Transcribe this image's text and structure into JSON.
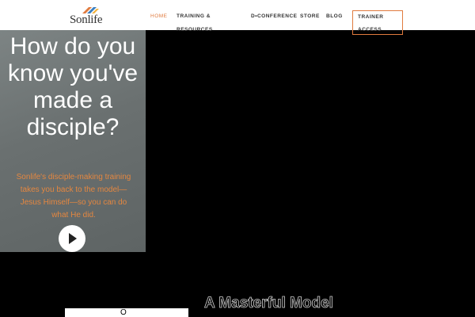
{
  "header": {
    "logo_text": "Sonlife",
    "nav": {
      "home": "HOME",
      "training_line1": "TRAINING &",
      "training_line2": "RESOURCES",
      "dconference": "D•CONFERENCE",
      "store": "STORE",
      "blog": "BLOG",
      "trainer_line1": "TRAINER",
      "trainer_line2": "ACCESS"
    }
  },
  "hero": {
    "title": "How do you know you've made a disciple?",
    "subtitle": "Sonlife's disciple-making training takes you back to the model—Jesus Himself—so you can do what He did."
  },
  "section": {
    "title": "A Masterful Model",
    "strip_glyph": "O"
  },
  "colors": {
    "accent": "#e07b3f",
    "hero_bg": "#6a7070",
    "page_bg": "#000000"
  }
}
